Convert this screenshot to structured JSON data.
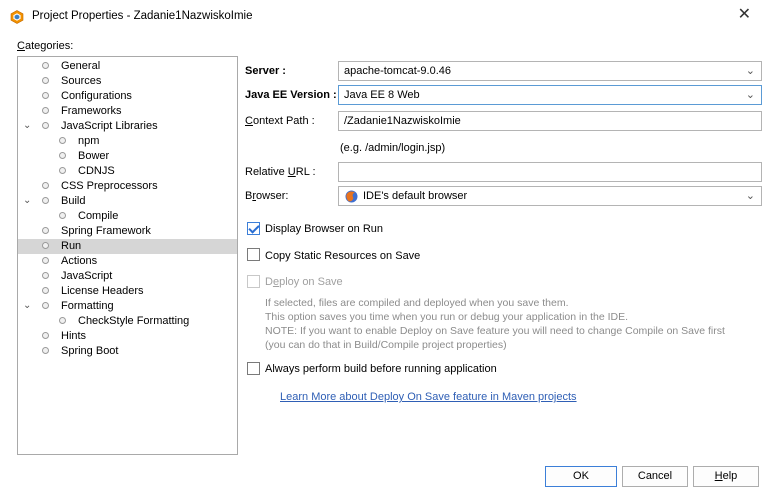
{
  "window": {
    "title": "Project Properties - Zadanie1NazwiskoImie"
  },
  "categories": {
    "label": "Categories:",
    "items": [
      {
        "label": "General"
      },
      {
        "label": "Sources"
      },
      {
        "label": "Configurations"
      },
      {
        "label": "Frameworks"
      },
      {
        "label": "JavaScript Libraries"
      },
      {
        "label": "npm"
      },
      {
        "label": "Bower"
      },
      {
        "label": "CDNJS"
      },
      {
        "label": "CSS Preprocessors"
      },
      {
        "label": "Build"
      },
      {
        "label": "Compile"
      },
      {
        "label": "Spring Framework"
      },
      {
        "label": "Run"
      },
      {
        "label": "Actions"
      },
      {
        "label": "JavaScript"
      },
      {
        "label": "License Headers"
      },
      {
        "label": "Formatting"
      },
      {
        "label": "CheckStyle Formatting"
      },
      {
        "label": "Hints"
      },
      {
        "label": "Spring Boot"
      }
    ]
  },
  "form": {
    "server_label": "Server :",
    "server_value": "apache-tomcat-9.0.46",
    "javaee_label": "Java EE Version :",
    "javaee_value": "Java EE 8 Web",
    "context_label": "Context Path :",
    "context_value": "/Zadanie1NazwiskoImie",
    "context_hint": "(e.g. /admin/login.jsp)",
    "relative_label": "Relative URL :",
    "relative_value": "",
    "browser_label": "Browser:",
    "browser_value": "IDE's default browser"
  },
  "options": {
    "display_browser": "Display Browser on Run",
    "copy_static": "Copy Static Resources on Save",
    "deploy_on_save": "Deploy on Save",
    "desc_line1": "If selected, files are compiled and deployed when you save them.",
    "desc_line2": "This option saves you time when you run or debug your application in the IDE.",
    "desc_line3": "NOTE: If you want to enable Deploy on Save feature you will need to change Compile on Save first",
    "desc_line4": "(you can do that in Build/Compile project properties)",
    "always_build": "Always perform build before running application",
    "learn_more": "Learn More about Deploy On Save feature in Maven projects"
  },
  "buttons": {
    "ok": "OK",
    "cancel": "Cancel",
    "help": "Help"
  },
  "colors": {
    "selected_row": "#d6d6d6",
    "link": "#2f5fb5",
    "focus_border": "#5b9bd5"
  }
}
